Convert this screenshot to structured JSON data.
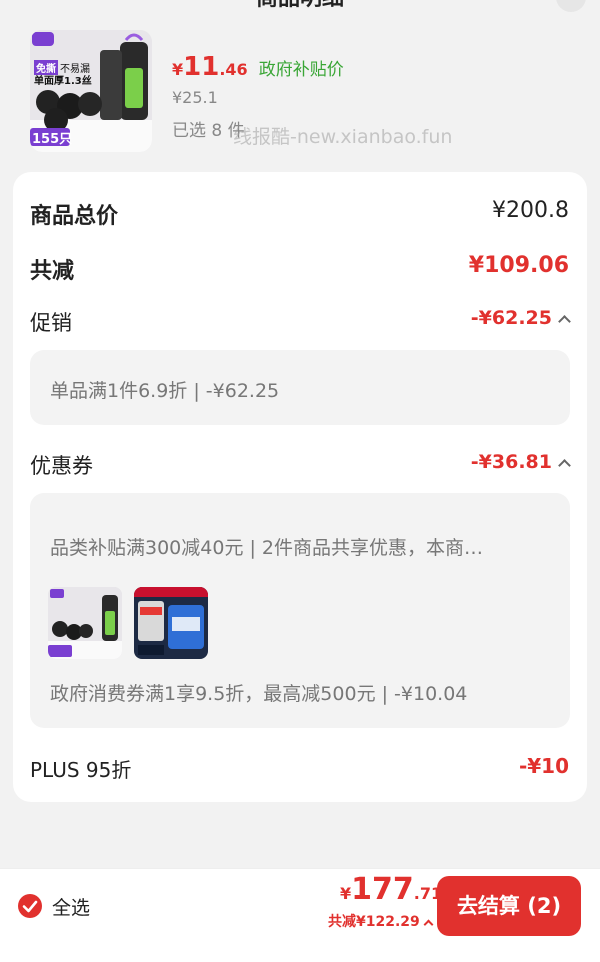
{
  "header": {
    "title": "商品明细"
  },
  "product": {
    "thumb_badge": "免撕",
    "thumb_line1": "不易漏",
    "thumb_line2": "单面厚1.3丝",
    "thumb_count": "155只",
    "price_symbol": "¥",
    "price_int": "11",
    "price_dec": ".46",
    "price_tag": "政府补贴价",
    "original_price": "¥25.1",
    "selected_qty": "已选 8 件"
  },
  "watermark": "线报酷-new.xianbao.fun",
  "summary": {
    "total_label": "商品总价",
    "total_value": "¥200.8",
    "reduce_label": "共减",
    "reduce_value": "¥109.06",
    "promo_label": "促销",
    "promo_value": "-¥62.25",
    "promo_detail": "单品满1件6.9折 | -¥62.25",
    "coupon_label": "优惠券",
    "coupon_value": "-¥36.81",
    "coupon_detail_1": "品类补贴满300减40元 | 2件商品共享优惠，本商…",
    "coupon_detail_2": "政府消费券满1享9.5折，最高减500元 | -¥10.04",
    "plus_label": "PLUS 95折",
    "plus_value": "-¥10"
  },
  "bottom_bar": {
    "select_all": "全选",
    "pay_symbol": "¥",
    "pay_int": "177",
    "pay_dec": ".71",
    "total_reduced": "共减¥122.29",
    "checkout_label": "去结算 (2)"
  },
  "colors": {
    "accent_red": "#e1312e",
    "subsidy_green": "#3aa636"
  },
  "icons": [
    "close-icon",
    "chevron-up-icon",
    "check-circle-icon"
  ]
}
